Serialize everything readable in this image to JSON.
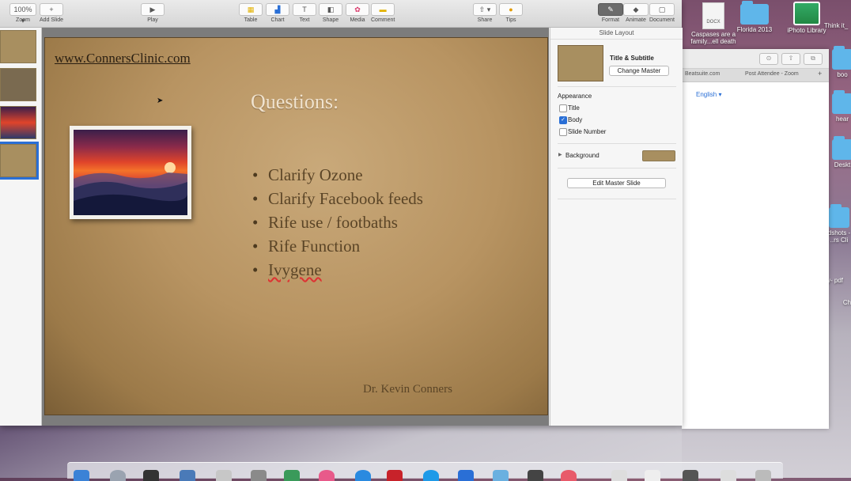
{
  "toolbar": {
    "zoom_value": "100%",
    "zoom_label": "Zoom",
    "add_slide_label": "Add Slide",
    "play_label": "Play",
    "table_label": "Table",
    "chart_label": "Chart",
    "text_label": "Text",
    "shape_label": "Shape",
    "media_label": "Media",
    "comment_label": "Comment",
    "share_label": "Share",
    "tips_label": "Tips",
    "format_label": "Format",
    "animate_label": "Animate",
    "document_label": "Document"
  },
  "slide": {
    "url": "www.ConnersClinic.com",
    "title": "Questions:",
    "bullets": [
      "Clarify Ozone",
      "Clarify Facebook feeds",
      "Rife use / footbaths",
      "Rife Function",
      "Ivygene"
    ],
    "footer": "Dr. Kevin Conners"
  },
  "inspector": {
    "header": "Slide Layout",
    "layout_name": "Title & Subtitle",
    "change_master": "Change Master",
    "appearance_label": "Appearance",
    "title_option": "Title",
    "body_option": "Body",
    "slide_number_option": "Slide Number",
    "background_label": "Background",
    "edit_master": "Edit Master Slide"
  },
  "safari": {
    "tab1": "Beatsuite.com",
    "tab2": "Post Attendee - Zoom",
    "language": "English"
  },
  "desktop": {
    "docx_tag": "DOCX",
    "file1": "Caspases are a family...ell death",
    "folder1": "Florida 2013",
    "folder2": "iPhoto Library",
    "edge1": "Think it_",
    "edge2": "boo",
    "edge3": "hear",
    "edge4": "Deskt",
    "edge5": "dshots - ..rs Cli",
    "edge6": "y- pdf",
    "edge7": "Ch"
  },
  "colors": {
    "accent": "#2a6fd6",
    "slide_bg": "#b89462",
    "title_text": "#f0e3cf",
    "body_text": "#5b4527"
  }
}
